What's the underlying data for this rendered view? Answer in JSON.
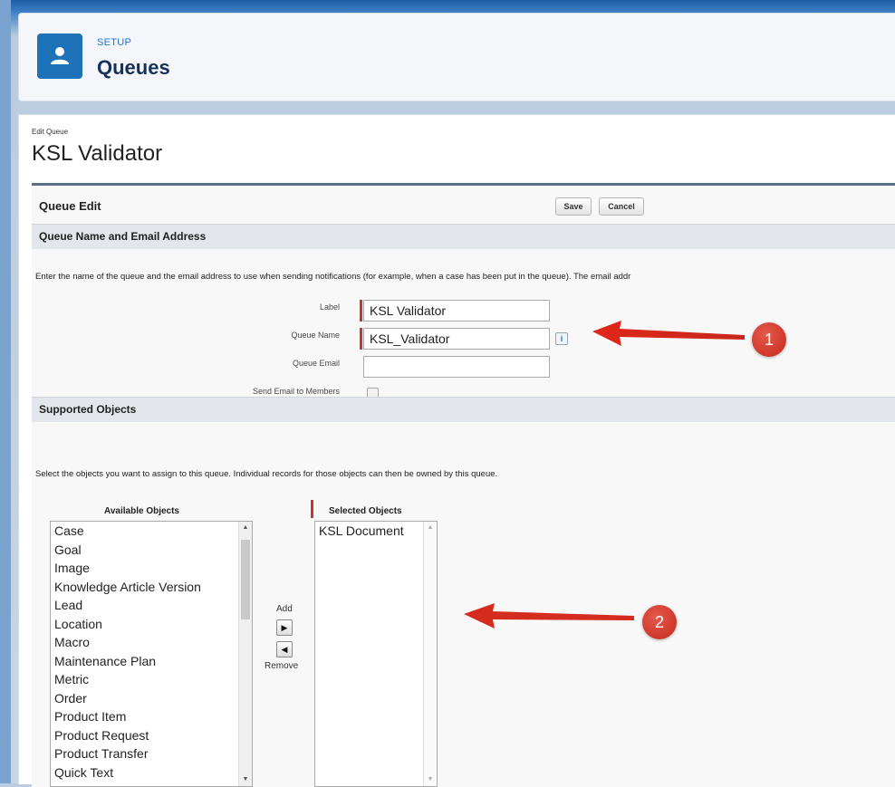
{
  "header": {
    "section": "SETUP",
    "title": "Queues"
  },
  "page": {
    "subtitle": "Edit Queue",
    "title": "KSL Validator"
  },
  "form": {
    "panel_title": "Queue Edit",
    "save_label": "Save",
    "cancel_label": "Cancel",
    "section_name_email": "Queue Name and Email Address",
    "section_name_email_help": "Enter the name of the queue and the email address to use when sending notifications (for example, when a case has been put in the queue). The email addr",
    "fields": {
      "label": {
        "label": "Label",
        "value": "KSL Validator"
      },
      "queue_name": {
        "label": "Queue Name",
        "value": "KSL_Validator",
        "info_icon": "i"
      },
      "queue_email": {
        "label": "Queue Email",
        "value": ""
      },
      "send_email": {
        "label": "Send Email to Members",
        "checked": false
      }
    },
    "section_objects": "Supported Objects",
    "section_objects_help": "Select the objects you want to assign to this queue. Individual records for those objects can then be owned by this queue.",
    "available_header": "Available Objects",
    "selected_header": "Selected Objects",
    "available_objects": [
      "Case",
      "Goal",
      "Image",
      "Knowledge Article Version",
      "Lead",
      "Location",
      "Macro",
      "Maintenance Plan",
      "Metric",
      "Order",
      "Product Item",
      "Product Request",
      "Product Transfer",
      "Quick Text"
    ],
    "selected_objects": [
      "KSL Document"
    ],
    "add_label": "Add",
    "remove_label": "Remove"
  },
  "annotations": {
    "badge_1": "1",
    "badge_2": "2"
  },
  "colors": {
    "brand": "#1e72b8",
    "required": "#c23934",
    "annotation": "#d42d1f"
  },
  "icons": {
    "header": "user-icon",
    "add": "right-arrow-icon",
    "remove": "left-arrow-icon"
  }
}
